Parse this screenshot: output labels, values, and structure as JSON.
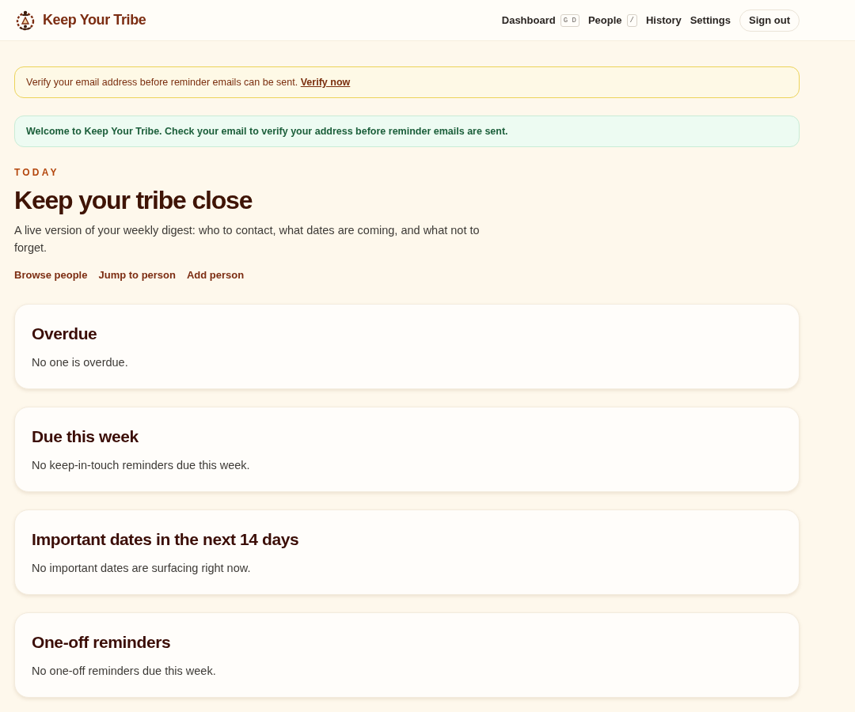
{
  "header": {
    "brand": "Keep Your Tribe",
    "nav": [
      {
        "label": "Dashboard",
        "shortcut": "G D"
      },
      {
        "label": "People",
        "shortcut": "/"
      },
      {
        "label": "History"
      },
      {
        "label": "Settings"
      }
    ],
    "sign_out": "Sign out"
  },
  "alerts": [
    {
      "kind": "warning",
      "text": "Verify your email address before reminder emails can be sent.",
      "link": "Verify now"
    },
    {
      "kind": "success",
      "text": "Welcome to Keep Your Tribe. Check your email to verify your address before reminder emails are sent."
    }
  ],
  "hero": {
    "eyebrow": "TODAY",
    "title": "Keep your tribe close",
    "description": "A live version of your weekly digest: who to contact, what dates are coming, and what not to forget.",
    "actions": [
      "Browse people",
      "Jump to person",
      "Add person"
    ]
  },
  "sections": [
    {
      "title": "Overdue",
      "empty_text": "No one is overdue."
    },
    {
      "title": "Due this week",
      "empty_text": "No keep-in-touch reminders due this week."
    },
    {
      "title": "Important dates in the next 14 days",
      "empty_text": "No important dates are surfacing right now."
    },
    {
      "title": "One-off reminders",
      "empty_text": "No one-off reminders due this week."
    }
  ]
}
